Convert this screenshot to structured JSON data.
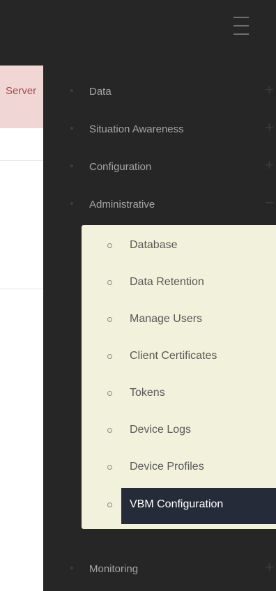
{
  "header": {
    "menu_icon": "hamburger-icon"
  },
  "alert": {
    "text": "Server"
  },
  "menu": {
    "items": [
      {
        "label": "Data",
        "toggle": "+"
      },
      {
        "label": "Situation Awareness",
        "toggle": "+"
      },
      {
        "label": "Configuration",
        "toggle": "+"
      },
      {
        "label": "Administrative",
        "toggle": "−"
      },
      {
        "label": "Monitoring",
        "toggle": "+"
      }
    ],
    "administrative_submenu": [
      {
        "label": "Database"
      },
      {
        "label": "Data Retention"
      },
      {
        "label": "Manage Users"
      },
      {
        "label": "Client Certificates"
      },
      {
        "label": "Tokens"
      },
      {
        "label": "Device Logs"
      },
      {
        "label": "Device Profiles"
      },
      {
        "label": "VBM Configuration",
        "active": true
      }
    ]
  },
  "colors": {
    "sidebar_bg": "#262626",
    "submenu_bg": "#f1f1dc",
    "active_bg": "#262b3a",
    "alert_bg": "#f1d6d6",
    "alert_text": "#b04747"
  }
}
